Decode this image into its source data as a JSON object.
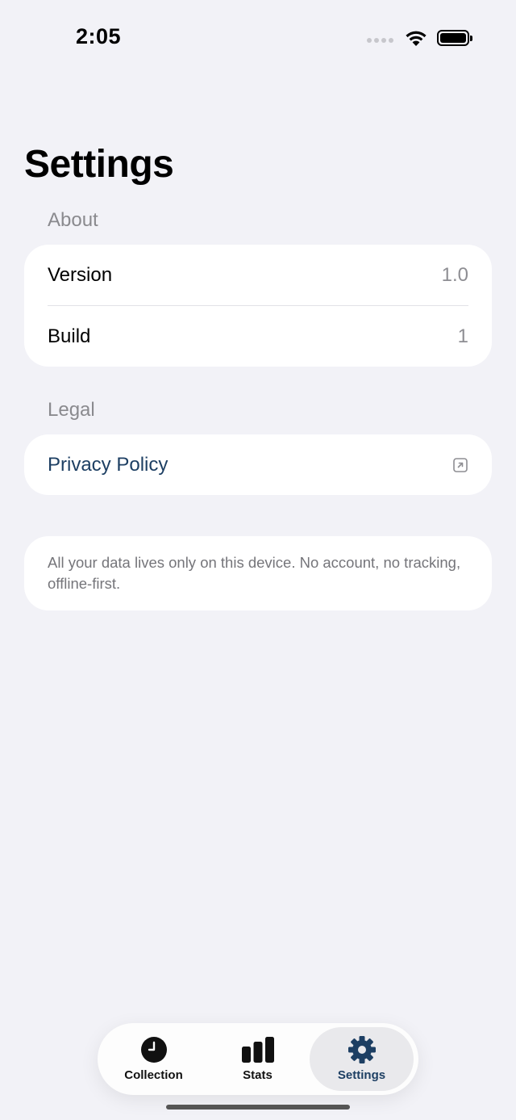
{
  "status_bar": {
    "time": "2:05"
  },
  "header": {
    "title": "Settings"
  },
  "sections": {
    "about": {
      "header": "About",
      "rows": [
        {
          "label": "Version",
          "value": "1.0"
        },
        {
          "label": "Build",
          "value": "1"
        }
      ]
    },
    "legal": {
      "header": "Legal",
      "privacy_label": "Privacy Policy",
      "privacy_icon": "external-link-icon"
    }
  },
  "note": "All your data lives only on this device. No account, no tracking, offline-first.",
  "tabbar": {
    "tabs": [
      {
        "label": "Collection",
        "icon": "clock-icon"
      },
      {
        "label": "Stats",
        "icon": "bar-chart-icon"
      },
      {
        "label": "Settings",
        "icon": "gear-icon",
        "active": true
      }
    ]
  },
  "colors": {
    "background": "#f2f2f7",
    "accent": "#1d3f63",
    "secondary_text": "#8e8e93"
  }
}
